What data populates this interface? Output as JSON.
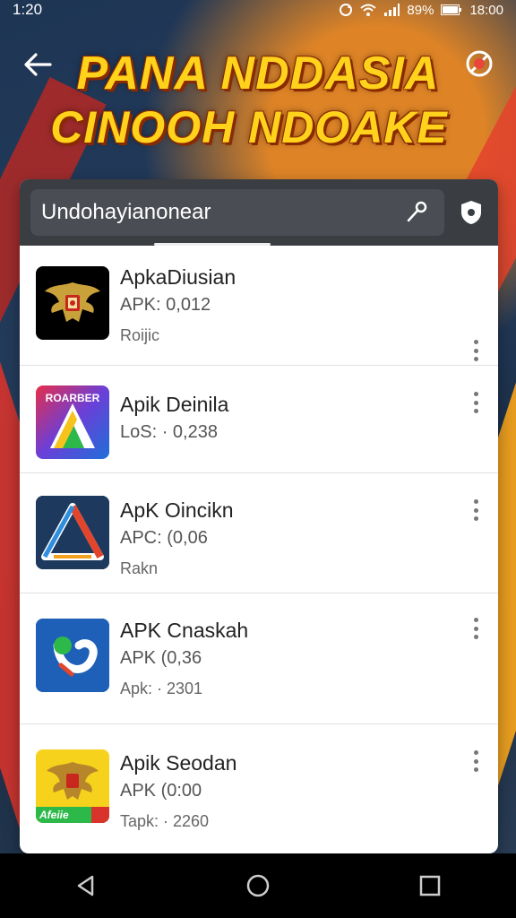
{
  "status_bar": {
    "time_left": "1:20",
    "battery": "89%",
    "time_right": "18:00"
  },
  "banner": {
    "title_line1": "PANA NDDASIA",
    "title_line2": "CINOOH NDOAKE"
  },
  "search": {
    "value": "Undohayianonear"
  },
  "apps": [
    {
      "name": "ApkaDiusian",
      "detail": "APK: 0,012",
      "extra": "Roijic",
      "icon": "garuda-emblem-icon"
    },
    {
      "name": "Apik Deinila",
      "detail": "LoS: · 0,238",
      "extra": "",
      "icon": "colorful-a-logo-icon"
    },
    {
      "name": "ApK Oincikn",
      "detail": "APC: (0,06",
      "extra": "Rakn",
      "icon": "triangle-a-logo-icon"
    },
    {
      "name": "APK Cnaskah",
      "detail": "APK (0,36",
      "extra": "Apk: · 2301",
      "icon": "blue-swoosh-logo-icon"
    },
    {
      "name": "Apik Seodan",
      "detail": "APK (0:00",
      "extra": "Tapk: · 2260",
      "icon": "garuda-yellow-icon",
      "badge": "Afeiie"
    }
  ],
  "icon_badge_text": "ROARBER",
  "colors": {
    "banner_text": "#ffd21c",
    "search_bar_bg": "#3a3d42",
    "accent_red": "#d8342c",
    "accent_orange": "#f2a21e"
  }
}
